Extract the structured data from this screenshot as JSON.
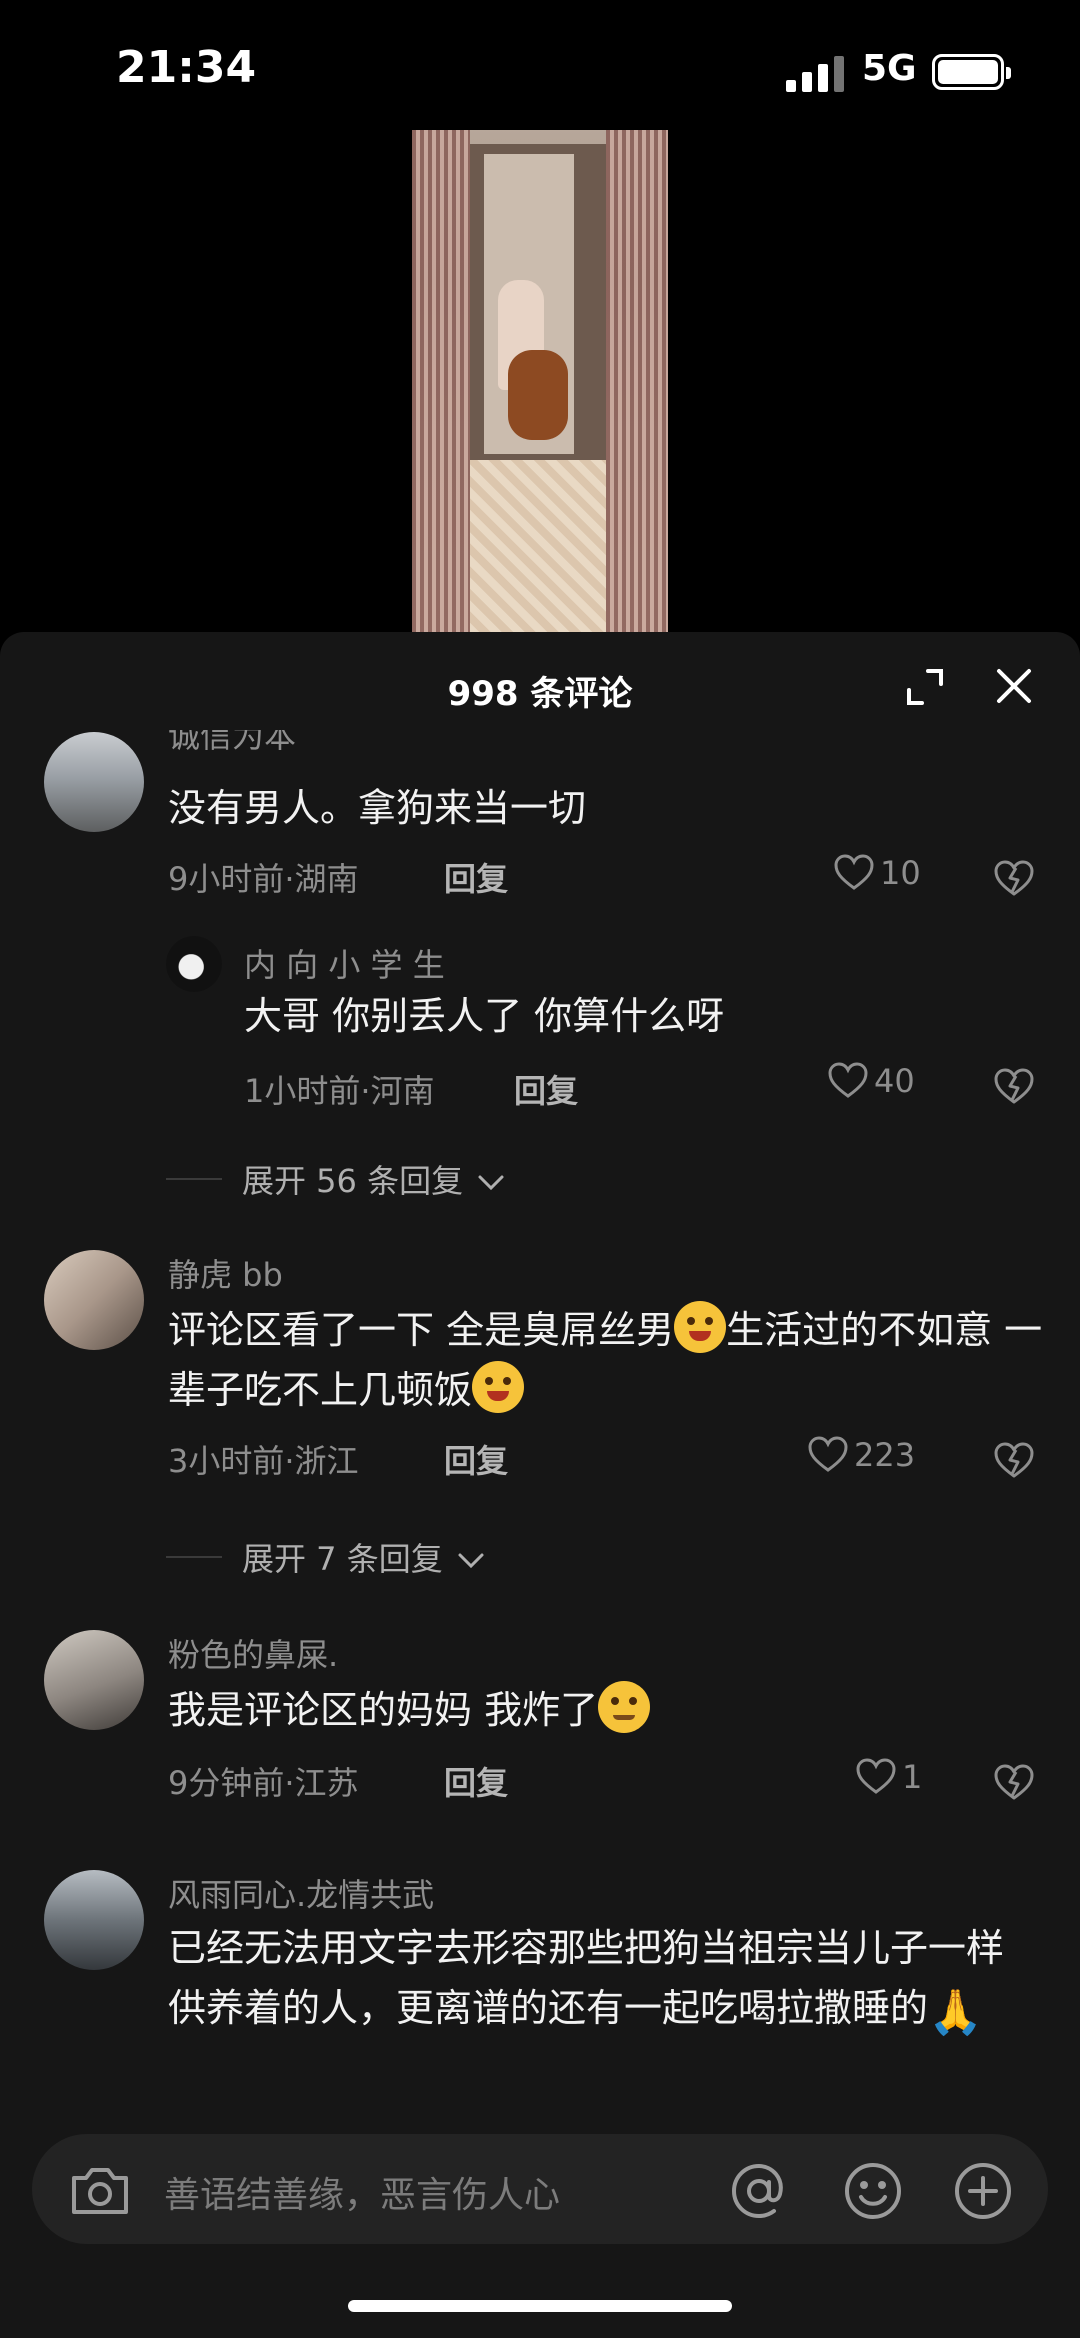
{
  "status": {
    "time": "21:34",
    "network": "5G"
  },
  "sheet": {
    "title": "998 条评论"
  },
  "comments": [
    {
      "user": "诚信为本",
      "text": "没有男人。拿狗来当一切",
      "meta": "9小时前·湖南",
      "reply_label": "回复",
      "likes": "10"
    },
    {
      "user": "内 向 小 学 生",
      "text": "大哥 你别丢人了 你算什么呀",
      "meta": "1小时前·河南",
      "reply_label": "回复",
      "likes": "40"
    },
    {
      "user": "静虎 bb",
      "text_part1": "评论区看了一下 全是臭屌丝男",
      "text_part2": "生活过的不如意 一辈子吃不上几顿饭",
      "meta": "3小时前·浙江",
      "reply_label": "回复",
      "likes": "223"
    },
    {
      "user": "粉色的鼻屎.",
      "text": "我是评论区的妈妈 我炸了",
      "meta": "9分钟前·江苏",
      "reply_label": "回复",
      "likes": "1"
    },
    {
      "user": "风雨同心.龙情共武",
      "text": "已经无法用文字去形容那些把狗当祖宗当儿子一样供养着的人，更离谱的还有一起吃喝拉撒睡的"
    }
  ],
  "expanders": [
    {
      "label": "展开 56 条回复"
    },
    {
      "label": "展开 7 条回复"
    }
  ],
  "input": {
    "placeholder": "善语结善缘，恶言伤人心"
  },
  "icons": {
    "expand": "expand-icon",
    "close": "close-icon",
    "heart": "heart-icon",
    "dislike": "dislike-icon",
    "camera": "camera-icon",
    "at": "at-icon",
    "emoji": "smile-icon",
    "add": "plus-icon"
  }
}
